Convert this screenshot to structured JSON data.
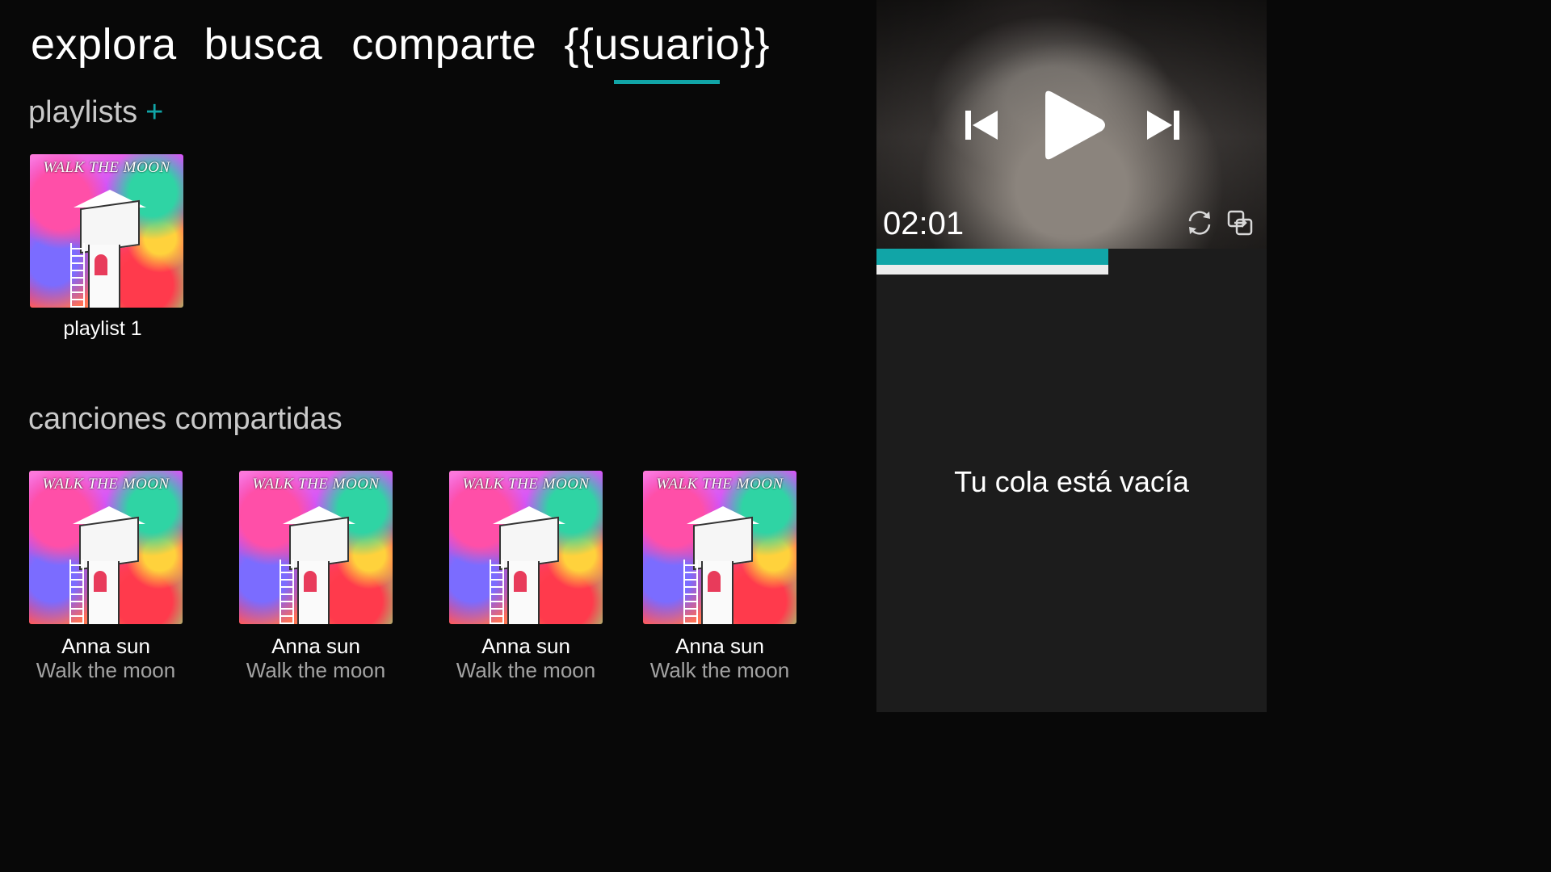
{
  "nav": {
    "tabs": [
      {
        "label": "explora"
      },
      {
        "label": "busca"
      },
      {
        "label": "comparte"
      },
      {
        "label": "{{usuario}}",
        "active": true
      }
    ]
  },
  "playlists": {
    "title": "playlists",
    "add_label": "+",
    "items": [
      {
        "label": "playlist 1",
        "cover_text": "WALK THE MOON"
      }
    ]
  },
  "shared": {
    "title": "canciones compartidas",
    "songs": [
      {
        "artist": "Anna sun",
        "title": "Walk the moon",
        "cover_text": "WALK THE MOON"
      },
      {
        "artist": "Anna sun",
        "title": "Walk the moon",
        "cover_text": "WALK THE MOON"
      },
      {
        "artist": "Anna sun",
        "title": "Walk the moon",
        "cover_text": "WALK THE MOON"
      },
      {
        "artist": "Anna sun",
        "title": "Walk the moon",
        "cover_text": "WALK THE MOON"
      }
    ]
  },
  "player": {
    "time": "02:01",
    "progress": 0.595,
    "icons": {
      "prev": "skip-previous-icon",
      "play": "play-icon",
      "next": "skip-next-icon",
      "repeat": "repeat-icon",
      "share": "share-icon"
    },
    "queue_empty": "Tu cola está vacía"
  },
  "colors": {
    "accent": "#11a5a7",
    "background": "#080808",
    "panel": "#1c1c1c",
    "secondary_text": "#a3a3a3"
  }
}
